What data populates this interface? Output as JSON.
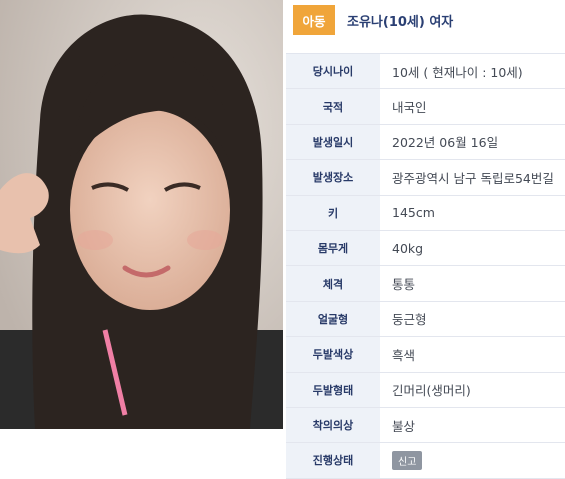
{
  "category_badge": "아동",
  "person_title": "조유나(10세) 여자",
  "details": [
    {
      "label": "당시나이",
      "value": "10세 ( 현재나이 : 10세)"
    },
    {
      "label": "국적",
      "value": "내국인"
    },
    {
      "label": "발생일시",
      "value": "2022년 06월 16일"
    },
    {
      "label": "발생장소",
      "value": "광주광역시 남구 독립로54번길"
    },
    {
      "label": "키",
      "value": "145cm"
    },
    {
      "label": "몸무게",
      "value": "40kg"
    },
    {
      "label": "체격",
      "value": "통통"
    },
    {
      "label": "얼굴형",
      "value": "둥근형"
    },
    {
      "label": "두발색상",
      "value": "흑색"
    },
    {
      "label": "두발형태",
      "value": "긴머리(생머리)"
    },
    {
      "label": "착의의상",
      "value": "불상"
    },
    {
      "label": "진행상태",
      "value": "신고"
    }
  ],
  "colors": {
    "badge": "#f0a53a",
    "label_bg": "#eef2f8",
    "title": "#2a3f73"
  }
}
